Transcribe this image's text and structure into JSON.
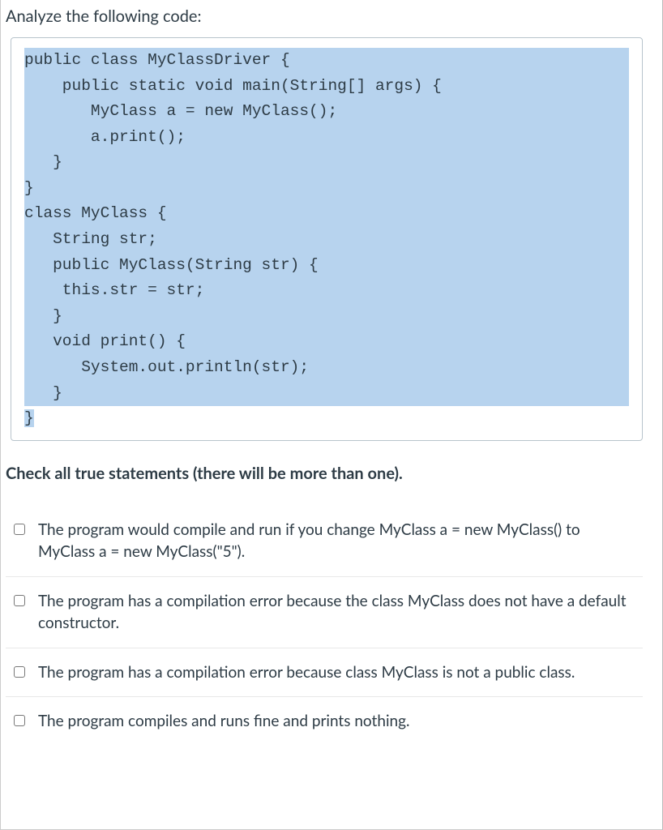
{
  "question": {
    "prompt": "Analyze the following code:",
    "code_lines": [
      "public class MyClassDriver {",
      "    public static void main(String[] args) {",
      "       MyClass a = new MyClass();",
      "       a.print();",
      "   }",
      "}",
      "class MyClass {",
      "   String str;",
      "   public MyClass(String str) {",
      "    this.str = str;",
      "   }",
      "   void print() {",
      "      System.out.println(str);",
      "   }",
      "}"
    ],
    "check_prompt": "Check all true statements (there will be more than one).",
    "options": [
      "The program would compile and run if you change MyClass a = new MyClass() to MyClass a = new MyClass(\"5\").",
      "The program has a compilation error because the class MyClass does not have a default constructor.",
      "The program has a compilation error because class MyClass is not a public class.",
      "The program compiles and runs fine and prints nothing."
    ]
  }
}
